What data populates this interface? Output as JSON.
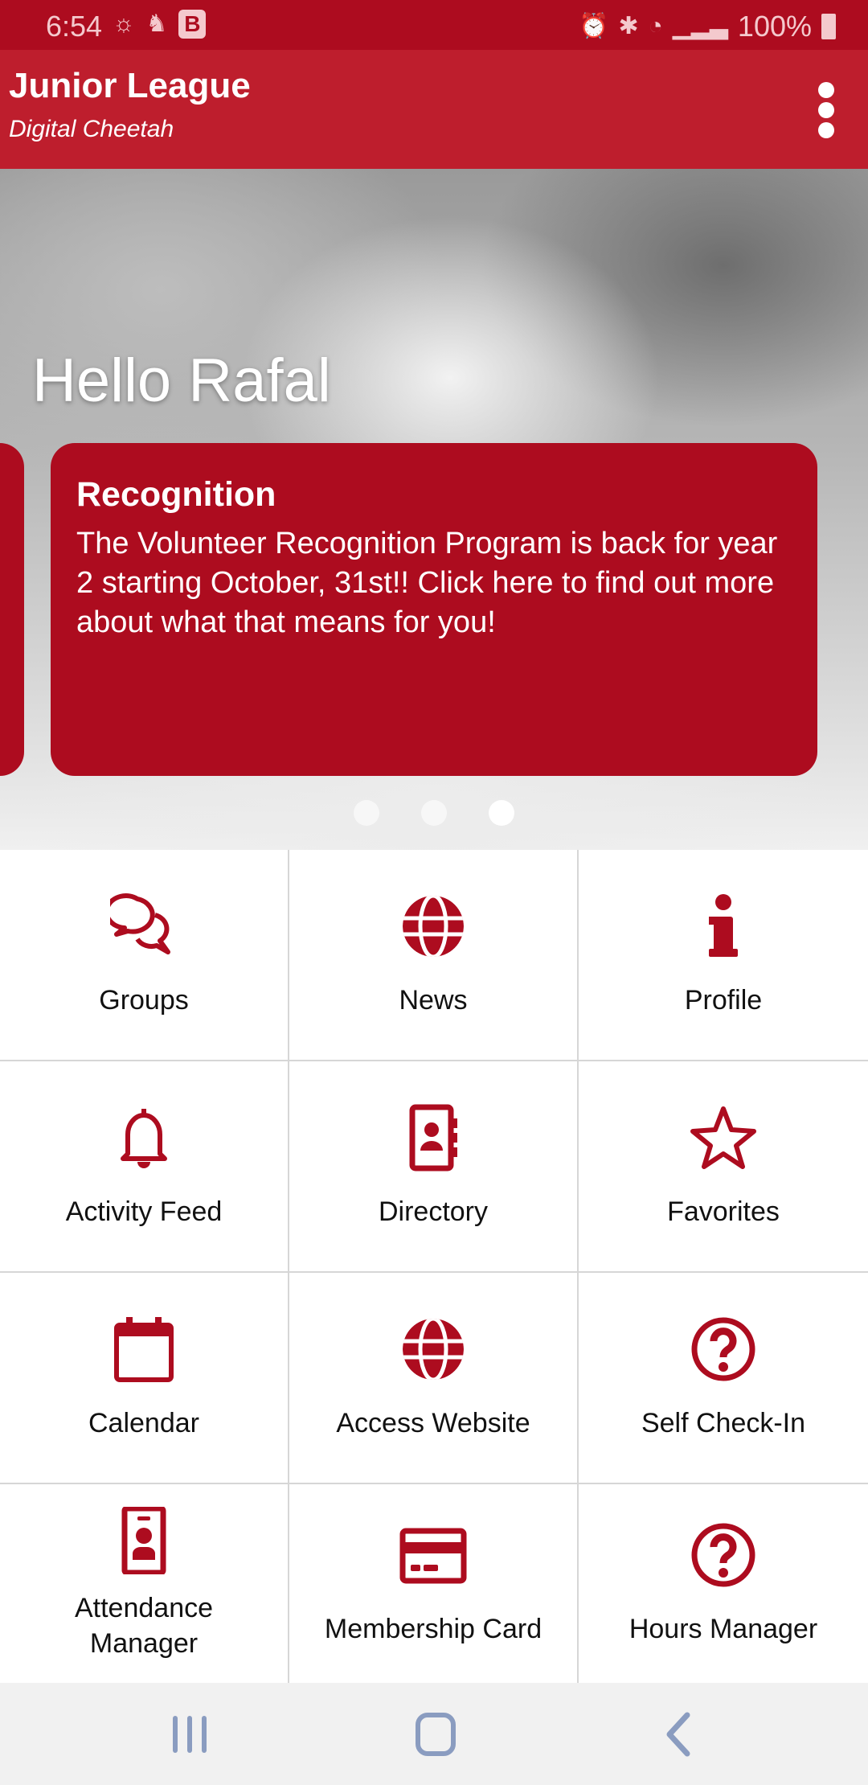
{
  "status_bar": {
    "time": "6:54",
    "battery": "100%",
    "icons_left": [
      "brightness-icon",
      "notification-icon",
      "b-app-icon"
    ],
    "b_badge": "B",
    "icons_right": [
      "alarm-icon",
      "bluetooth-icon",
      "wifi-icon",
      "signal-icon",
      "battery-icon"
    ]
  },
  "header": {
    "title": "Junior League",
    "subtitle": "Digital Cheetah",
    "menu_icon": "more-vert-icon"
  },
  "hero": {
    "greeting": "Hello Rafal",
    "card": {
      "title": "Recognition",
      "body": "The Volunteer Recognition Program is back for year 2 starting October, 31st!! Click here to find out more about what that means for you!"
    },
    "pager": {
      "count": 3,
      "active": 3
    }
  },
  "grid": [
    {
      "label": "Groups",
      "icon": "chat-bubbles-icon"
    },
    {
      "label": "News",
      "icon": "globe-icon"
    },
    {
      "label": "Profile",
      "icon": "info-icon"
    },
    {
      "label": "Activity Feed",
      "icon": "bell-icon"
    },
    {
      "label": "Directory",
      "icon": "address-book-icon"
    },
    {
      "label": "Favorites",
      "icon": "star-icon"
    },
    {
      "label": "Calendar",
      "icon": "calendar-icon"
    },
    {
      "label": "Access Website",
      "icon": "globe-icon"
    },
    {
      "label": "Self Check-In",
      "icon": "question-circle-icon"
    },
    {
      "label": "Attendance Manager",
      "icon": "id-badge-icon"
    },
    {
      "label": "Membership Card",
      "icon": "credit-card-icon"
    },
    {
      "label": "Hours Manager",
      "icon": "question-circle-icon"
    }
  ],
  "colors": {
    "status_bar": "#ad0c1f",
    "header": "#be1e2d",
    "accent": "#ad0c1f",
    "nav_bar": "#f1f1f1"
  },
  "nav": [
    "recent-apps-icon",
    "home-icon",
    "back-icon"
  ]
}
